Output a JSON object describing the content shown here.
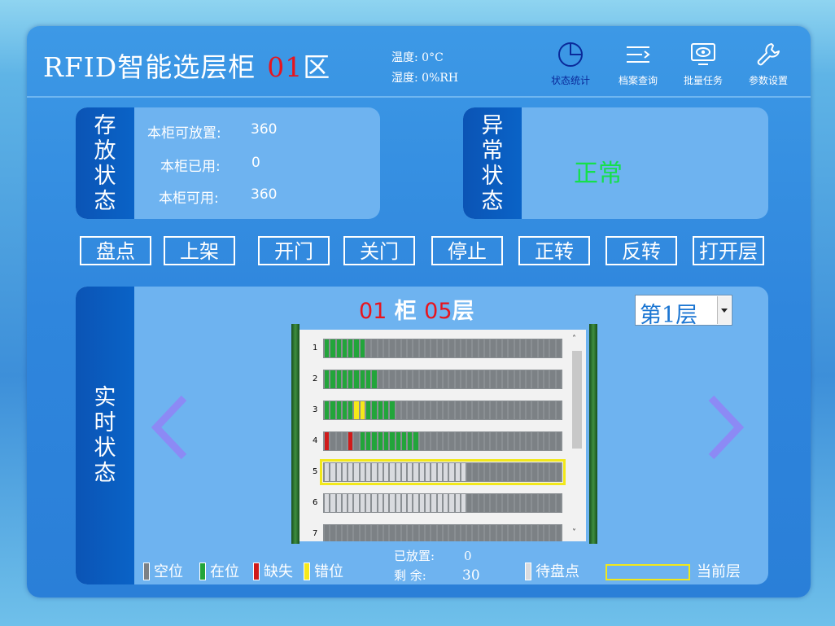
{
  "header": {
    "title_prefix": "RFID智能选层柜",
    "zone_number": "01",
    "zone_suffix": "区",
    "temperature": "温度: 0°C",
    "humidity": "湿度: 0%RH"
  },
  "nav": [
    {
      "label": "状态统计",
      "icon": "pie-chart-icon",
      "active": true
    },
    {
      "label": "档案查询",
      "icon": "list-search-icon",
      "active": false
    },
    {
      "label": "批量任务",
      "icon": "monitor-eye-icon",
      "active": false
    },
    {
      "label": "参数设置",
      "icon": "wrench-icon",
      "active": false
    }
  ],
  "storage_panel": {
    "tag": "存放状态",
    "rows": [
      {
        "label": "本柜可放置:",
        "value": "360"
      },
      {
        "label": "本柜已用:",
        "value": "0"
      },
      {
        "label": "本柜可用:",
        "value": "360"
      }
    ]
  },
  "alarm_panel": {
    "tag": "异常状态",
    "status": "正常"
  },
  "buttons": [
    "盘点",
    "上架",
    "开门",
    "关门",
    "停止",
    "正转",
    "反转",
    "打开层"
  ],
  "realtime_panel": {
    "tag": "实时状态",
    "cabinet_number": "01",
    "cabinet_label": "柜",
    "layer_number": "05",
    "layer_label": "层",
    "layer_select": "第1层",
    "rows": [
      {
        "num": "1",
        "slots": "gggggggeeeeeeeeeeeeeeeeeeeeeeeeeeeeeeeee"
      },
      {
        "num": "2",
        "slots": "gggggggggeeeeeeeeeeeeeeeeeeeeeeeeeeeeeee"
      },
      {
        "num": "3",
        "slots": "gggggyygggggeeeeeeeeeeeeeeeeeeeeeeeeeeee"
      },
      {
        "num": "4",
        "slots": "reeereggggggggggeeeeeeeeeeeeeeeeeeeeeeee"
      },
      {
        "num": "5",
        "slots": "wwwwwwwwwwwwwwwwwwwwwwwweeeeeeeeeeeeeeee",
        "current": true
      },
      {
        "num": "6",
        "slots": "wwwwwwwwwwwwwwwwwwwwwwwweeeeeeeeeeeeeeee"
      },
      {
        "num": "7",
        "slots": "eeeeeeeeeeeeeeeeeeeeeeeeeeeeeeeeeeeeeeee"
      }
    ],
    "placed_label": "已放置:",
    "placed_value": "0",
    "remain_label": "剩  余:",
    "remain_value": "30"
  },
  "legend": [
    {
      "label": "空位",
      "color": "#7c8185"
    },
    {
      "label": "在位",
      "color": "#22a53a"
    },
    {
      "label": "缺失",
      "color": "#d01a1a"
    },
    {
      "label": "错位",
      "color": "#f6e81a"
    },
    {
      "label": "待盘点",
      "color": "#d9dbdf"
    },
    {
      "label": "当前层",
      "color": "#f2e81a"
    }
  ]
}
